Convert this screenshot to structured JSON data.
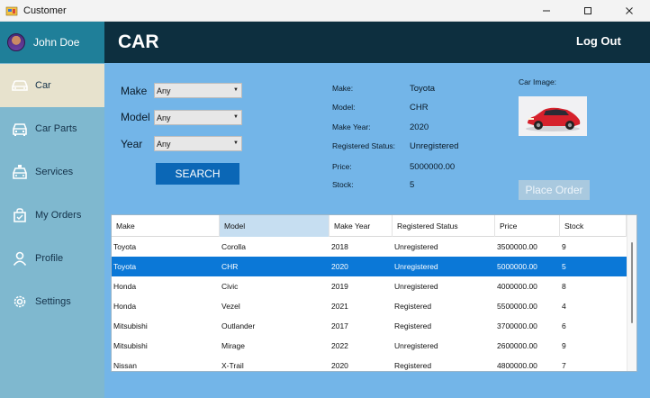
{
  "window": {
    "title": "Customer"
  },
  "sidebar": {
    "user_name": "John Doe",
    "items": [
      {
        "label": "Car"
      },
      {
        "label": "Car Parts"
      },
      {
        "label": "Services"
      },
      {
        "label": "My Orders"
      },
      {
        "label": "Profile"
      },
      {
        "label": "Settings"
      }
    ]
  },
  "header": {
    "title": "CAR",
    "logout_label": "Log Out"
  },
  "filters": {
    "make_label": "Make",
    "make_value": "Any",
    "model_label": "Model",
    "model_value": "Any",
    "year_label": "Year",
    "year_value": "Any",
    "search_label": "SEARCH"
  },
  "details": {
    "make_label": "Make:",
    "make_value": "Toyota",
    "model_label": "Model:",
    "model_value": "CHR",
    "year_label": "Make Year:",
    "year_value": "2020",
    "status_label": "Registered Status:",
    "status_value": "Unregistered",
    "price_label": "Price:",
    "price_value": "5000000.00",
    "stock_label": "Stock:",
    "stock_value": "5",
    "image_label": "Car Image:",
    "place_order_label": "Place Order"
  },
  "table": {
    "columns": [
      "Make",
      "Model",
      "Make Year",
      "Registered Status",
      "Price",
      "Stock"
    ],
    "rows": [
      [
        "Toyota",
        "Corolla",
        "2018",
        "Unregistered",
        "3500000.00",
        "9"
      ],
      [
        "Toyota",
        "CHR",
        "2020",
        "Unregistered",
        "5000000.00",
        "5"
      ],
      [
        "Honda",
        "Civic",
        "2019",
        "Unregistered",
        "4000000.00",
        "8"
      ],
      [
        "Honda",
        "Vezel",
        "2021",
        "Registered",
        "5500000.00",
        "4"
      ],
      [
        "Mitsubishi",
        "Outlander",
        "2017",
        "Registered",
        "3700000.00",
        "6"
      ],
      [
        "Mitsubishi",
        "Mirage",
        "2022",
        "Unregistered",
        "2600000.00",
        "9"
      ],
      [
        "Nissan",
        "X-Trail",
        "2020",
        "Registered",
        "4800000.00",
        "7"
      ]
    ],
    "selected_row": 1
  },
  "colors": {
    "header": "#0d2f3f",
    "sidebar": "#7fb8cf",
    "main": "#73b5e8",
    "accent": "#0b67b6",
    "selection": "#0b78d7",
    "car": "#d6212c"
  }
}
